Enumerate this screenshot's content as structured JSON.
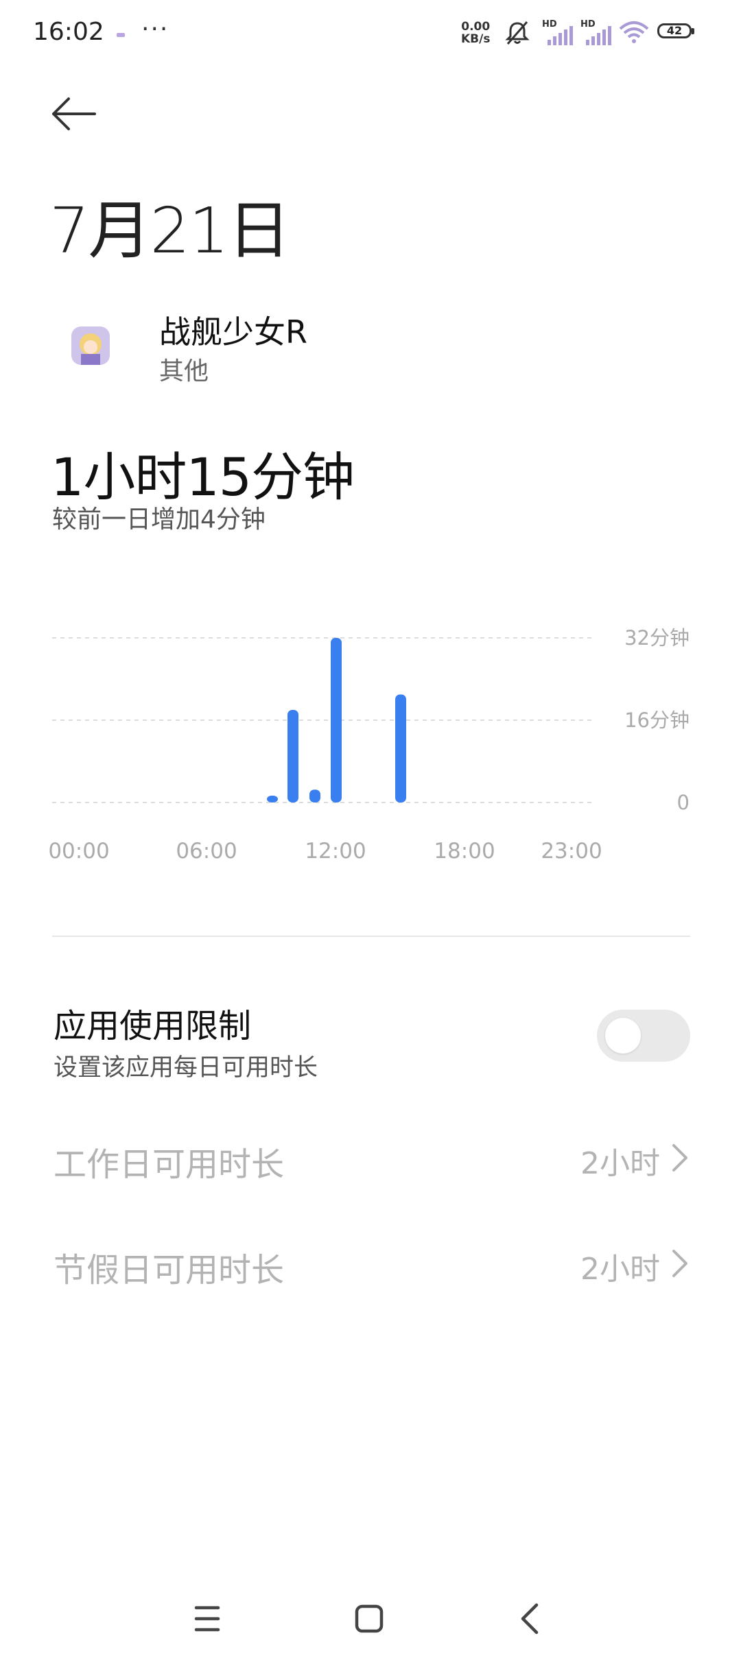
{
  "status_bar": {
    "time": "16:02",
    "dots": "···",
    "net_speed_value": "0.00",
    "net_speed_unit": "KB/s",
    "hd_label": "HD",
    "battery": "42"
  },
  "header": {
    "date_title": "7月21日"
  },
  "app": {
    "name": "战舰少女R",
    "category": "其他"
  },
  "usage": {
    "total": "1小时15分钟",
    "compare": "较前一日增加4分钟"
  },
  "chart_data": {
    "type": "bar",
    "x_tick_labels": [
      "00:00",
      "06:00",
      "12:00",
      "18:00",
      "23:00"
    ],
    "y_tick_labels": [
      "32分钟",
      "16分钟",
      "0"
    ],
    "ylim": [
      0,
      32
    ],
    "grid": true,
    "color": "#3a7ff0",
    "hours": [
      9,
      10,
      11,
      12,
      15
    ],
    "values": [
      1,
      18,
      2.5,
      32,
      21
    ]
  },
  "limit": {
    "title": "应用使用限制",
    "description": "设置该应用每日可用时长",
    "enabled": false
  },
  "rows": [
    {
      "label": "工作日可用时长",
      "value": "2小时"
    },
    {
      "label": "节假日可用时长",
      "value": "2小时"
    }
  ]
}
